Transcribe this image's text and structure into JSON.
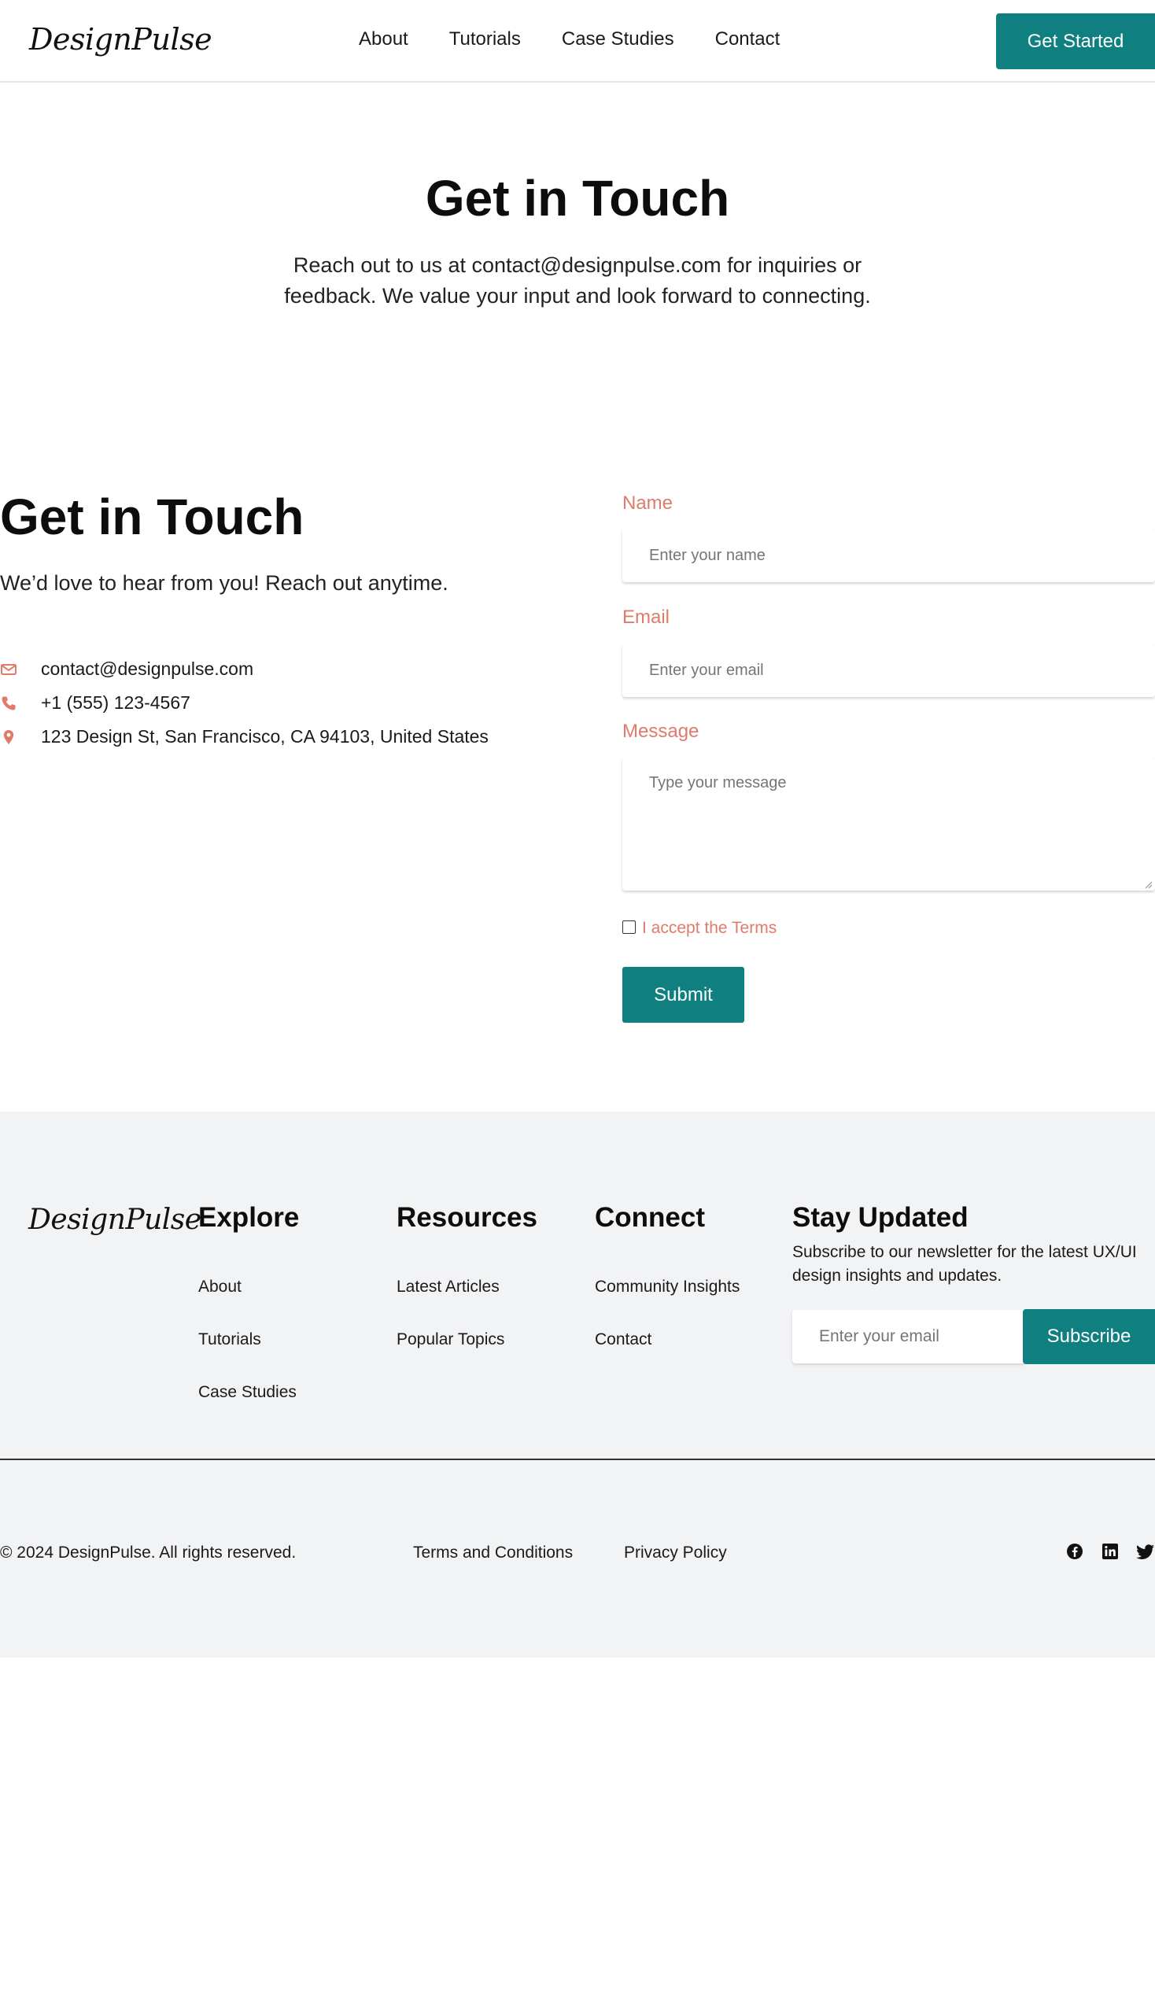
{
  "header": {
    "logo": "DesignPulse",
    "nav": [
      "About",
      "Tutorials",
      "Case Studies",
      "Contact"
    ],
    "cta": "Get Started"
  },
  "hero": {
    "title": "Get in Touch",
    "subtitle": "Reach out to us at contact@designpulse.com for inquiries or feedback. We value your input and look forward to connecting."
  },
  "contact": {
    "title": "Get in Touch",
    "subtitle": "We’d love to hear from you! Reach out anytime.",
    "email": "contact@designpulse.com",
    "phone": "+1 (555) 123-4567",
    "address": "123 Design St, San Francisco, CA 94103, United States",
    "icon_color": "#e07b6a"
  },
  "form": {
    "name_label": "Name",
    "name_placeholder": "Enter your name",
    "email_label": "Email",
    "email_placeholder": "Enter your email",
    "message_label": "Message",
    "message_placeholder": "Type your message",
    "terms_label": "I accept the Terms",
    "terms_checked": false,
    "submit": "Submit",
    "accent": "#0f7f7f",
    "label_color": "#e07b6a"
  },
  "footer": {
    "logo": "DesignPulse",
    "explore": {
      "title": "Explore",
      "links": [
        "About",
        "Tutorials",
        "Case Studies"
      ]
    },
    "resources": {
      "title": "Resources",
      "links": [
        "Latest Articles",
        "Popular Topics"
      ]
    },
    "connect": {
      "title": "Connect",
      "links": [
        "Community Insights",
        "Contact"
      ]
    },
    "newsletter": {
      "title": "Stay Updated",
      "subtitle": "Subscribe to our newsletter for the latest UX/UI design insights and updates.",
      "placeholder": "Enter your email",
      "button": "Subscribe"
    },
    "copyright": "© 2024 DesignPulse. All rights reserved.",
    "terms": "Terms and Conditions",
    "privacy": "Privacy Policy",
    "social": [
      "facebook-icon",
      "linkedin-icon",
      "twitter-icon"
    ]
  }
}
